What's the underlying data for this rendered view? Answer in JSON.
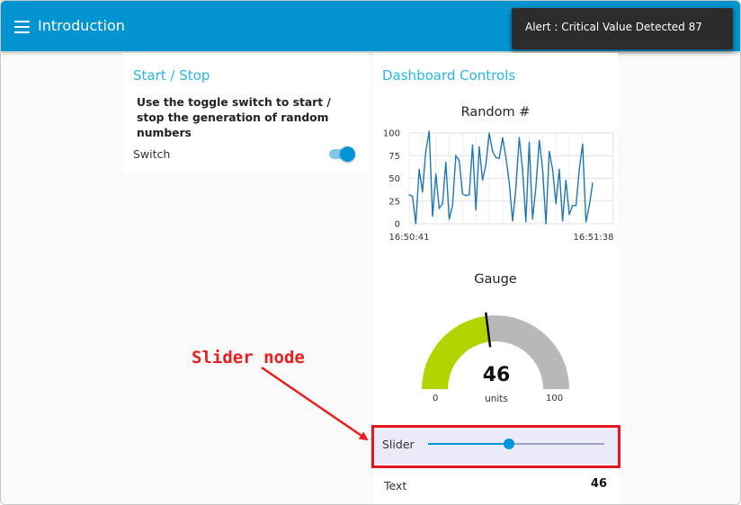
{
  "header": {
    "title": "Introduction",
    "menu_icon": "hamburger-menu-icon"
  },
  "toast": {
    "text": "Alert : Critical Value Detected 87"
  },
  "start_stop": {
    "title": "Start / Stop",
    "instructions": "Use the toggle switch to start / stop the generation of random numbers",
    "switch_label": "Switch",
    "switch_on": true
  },
  "dashboard": {
    "title": "Dashboard Controls",
    "chart_title": "Random #",
    "gauge": {
      "title": "Gauge",
      "value": "46",
      "units": "units",
      "min": "0",
      "max": "100",
      "value_num": 46,
      "min_num": 0,
      "max_num": 100,
      "color_filled": "#b3d400",
      "color_empty": "#b8b8b8"
    },
    "slider": {
      "label": "Slider",
      "value": 46,
      "min": 0,
      "max": 100
    },
    "text": {
      "label": "Text",
      "value": "46"
    }
  },
  "annotation": {
    "label": "Slider node",
    "color": "#ee1c1c"
  },
  "chart_data": {
    "type": "line",
    "title": "Random #",
    "xlabel": "",
    "ylabel": "",
    "x_tick_labels": [
      "16:50:41",
      "16:51:38"
    ],
    "y_ticks": [
      0,
      25,
      50,
      75,
      100
    ],
    "ylim": [
      0,
      100
    ],
    "grid": true,
    "series": [
      {
        "color": "#1f77b4",
        "values": [
          32,
          30,
          0,
          60,
          35,
          80,
          102,
          8,
          55,
          17,
          22,
          68,
          5,
          20,
          75,
          70,
          33,
          31,
          32,
          87,
          15,
          85,
          48,
          65,
          100,
          80,
          73,
          72,
          95,
          73,
          45,
          3,
          40,
          95,
          60,
          2,
          90,
          5,
          40,
          92,
          60,
          0,
          80,
          60,
          22,
          60,
          3,
          48,
          10,
          20,
          20,
          60,
          88,
          2,
          20,
          45
        ]
      }
    ]
  }
}
